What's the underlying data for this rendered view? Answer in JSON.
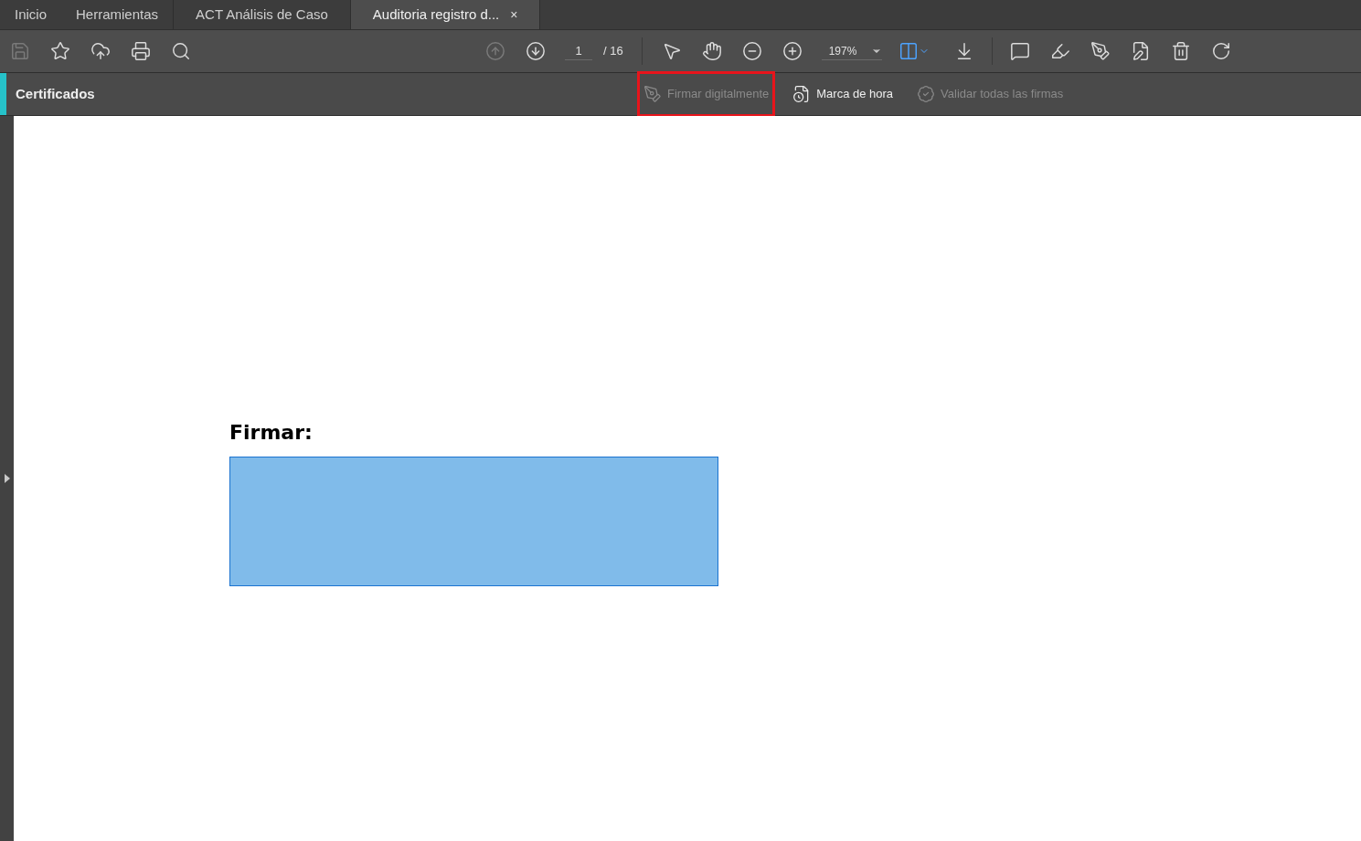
{
  "tabs": [
    {
      "label": "Inicio",
      "kind": "nav",
      "selected": false
    },
    {
      "label": "Herramientas",
      "kind": "nav",
      "selected": false
    },
    {
      "label": "ACT Análisis de Caso",
      "kind": "doc",
      "selected": false
    },
    {
      "label": "Auditoria registro d...",
      "kind": "doc",
      "selected": true,
      "close": "×"
    }
  ],
  "toolbar": {
    "file_tools": [
      {
        "kind": "save",
        "disabled": true
      },
      {
        "kind": "bookmark",
        "disabled": false
      },
      {
        "kind": "upload",
        "disabled": false
      },
      {
        "kind": "print",
        "disabled": false
      },
      {
        "kind": "find",
        "disabled": false
      }
    ],
    "page_nav": [
      {
        "kind": "prev",
        "disabled": true
      },
      {
        "kind": "next",
        "disabled": false
      }
    ],
    "page_number": "1",
    "page_total": "/ 16",
    "view_tools": [
      {
        "kind": "pointer",
        "disabled": false
      },
      {
        "kind": "hand",
        "disabled": false
      },
      {
        "kind": "zoom-out",
        "disabled": false
      },
      {
        "kind": "zoom-in",
        "disabled": false
      }
    ],
    "zoom": "197%",
    "page_fit": {
      "selected": true
    },
    "edit_tools": [
      {
        "kind": "comment",
        "disabled": false
      },
      {
        "kind": "highlight",
        "disabled": false
      },
      {
        "kind": "sign",
        "disabled": false
      },
      {
        "kind": "edit",
        "disabled": false
      },
      {
        "kind": "delete",
        "disabled": false
      },
      {
        "kind": "rotate",
        "disabled": false
      }
    ]
  },
  "certificates_bar": {
    "title": "Certificados",
    "actions": [
      {
        "kind": "sign",
        "label": "Firmar digitalmente",
        "disabled": true,
        "highlighted": true
      },
      {
        "kind": "timestamp",
        "label": "Marca de hora",
        "disabled": false,
        "highlighted": false
      },
      {
        "kind": "validate",
        "label": "Validar todas las firmas",
        "disabled": true,
        "highlighted": false
      }
    ]
  },
  "document": {
    "heading": "Firmar:"
  }
}
